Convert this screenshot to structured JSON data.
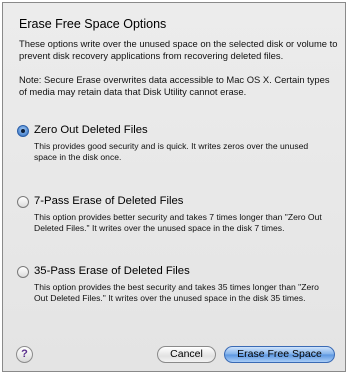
{
  "dialog": {
    "title": "Erase Free Space Options",
    "description": "These options write over the unused space on the selected disk or volume to prevent disk recovery applications from recovering deleted files.",
    "note": "Note: Secure Erase overwrites data accessible to Mac OS X.  Certain types of media may retain data that Disk Utility cannot erase."
  },
  "options": [
    {
      "label": "Zero Out Deleted Files",
      "description": "This provides good security and is quick. It writes zeros over the unused space in the disk once.",
      "selected": true
    },
    {
      "label": "7-Pass Erase of Deleted Files",
      "description": "This option provides better security and takes 7 times longer than \"Zero Out Deleted Files.\" It writes over the unused space in the disk 7 times.",
      "selected": false
    },
    {
      "label": "35-Pass Erase of Deleted Files",
      "description": "This option provides the best security and takes 35 times longer than \"Zero Out Deleted Files.\" It writes over the unused space in the disk 35 times.",
      "selected": false
    }
  ],
  "buttons": {
    "help": "?",
    "cancel": "Cancel",
    "primary": "Erase Free Space"
  },
  "colors": {
    "accent": "#5b96e0",
    "background": "#e8e8e8"
  }
}
